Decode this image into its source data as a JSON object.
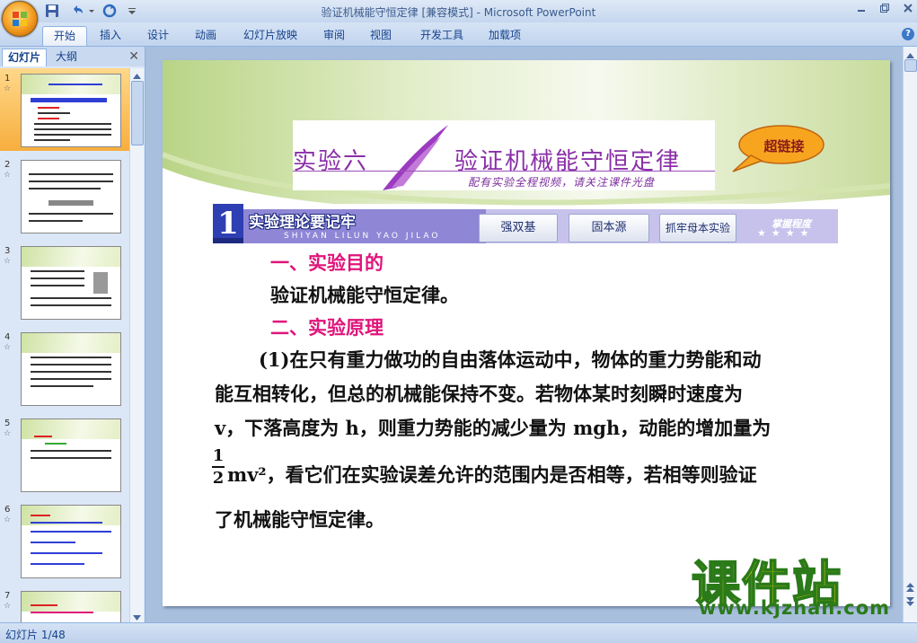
{
  "window": {
    "title": "验证机械能守恒定律 [兼容模式] - Microsoft PowerPoint"
  },
  "ribbon": {
    "tabs": [
      "开始",
      "插入",
      "设计",
      "动画",
      "幻灯片放映",
      "审阅",
      "视图",
      "开发工具",
      "加载项"
    ],
    "active_tab": "开始"
  },
  "left_pane": {
    "tabs": [
      "幻灯片",
      "大纲"
    ],
    "close_symbol": "✕",
    "slides": [
      {
        "num": "1",
        "selected": true
      },
      {
        "num": "2",
        "selected": false
      },
      {
        "num": "3",
        "selected": false
      },
      {
        "num": "4",
        "selected": false
      },
      {
        "num": "5",
        "selected": false
      },
      {
        "num": "6",
        "selected": false
      },
      {
        "num": "7",
        "selected": false
      }
    ]
  },
  "slide": {
    "banner_left": "实验六",
    "banner_right": "验证机械能守恒定律",
    "banner_sub": "配有实验全程视频，请关注课件光盘",
    "hyperlink_bubble": "超链接",
    "section_number": "1",
    "section_title": "实验理论要记牢",
    "section_pinyin": "SHIYAN LILUN YAO JILAO",
    "section_buttons": [
      "强双基",
      "固本源",
      "抓牢母本实验"
    ],
    "mastery_label": "掌握程度",
    "heading1": "一、实验目的",
    "purpose": "验证机械能守恒定律。",
    "heading2": "二、实验原理",
    "lines": [
      "(1)在只有重力做功的自由落体运动中，物体的重力势能和动",
      "能互相转化，但总的机械能保持不变。若物体某时刻瞬时速度为",
      "v，下落高度为 h，则重力势能的减少量为 mgh，动能的增加量为",
      "mv²，看它们在实验误差允许的范围内是否相等，若相等则验证",
      "了机械能守恒定律。"
    ],
    "fraction": {
      "numerator": "1",
      "denominator": "2"
    }
  },
  "watermark": {
    "main": "课件站",
    "url": "www.kjzhan.com"
  },
  "status": {
    "text": "幻灯片 1/48"
  }
}
